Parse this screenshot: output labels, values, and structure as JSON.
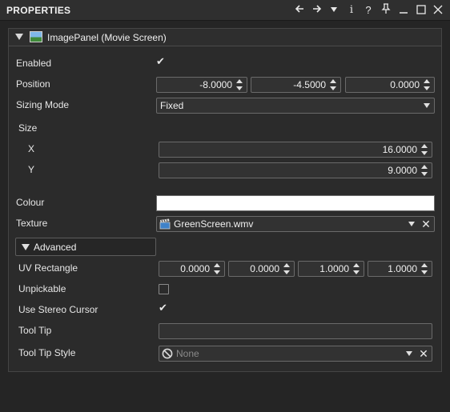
{
  "window": {
    "title": "PROPERTIES",
    "icons": [
      "arrow-left-icon",
      "arrow-right-icon",
      "dropdown-icon",
      "info-icon",
      "help-icon",
      "pin-icon",
      "minimize-icon",
      "maximize-icon",
      "close-icon"
    ]
  },
  "panel": {
    "title": "ImagePanel (Movie Screen)",
    "icon": "image-icon"
  },
  "props": {
    "enabled": {
      "label": "Enabled",
      "checked": true
    },
    "position": {
      "label": "Position",
      "values": [
        "-8.0000",
        "-4.5000",
        "0.0000"
      ]
    },
    "sizing_mode": {
      "label": "Sizing Mode",
      "value": "Fixed"
    },
    "size": {
      "label": "Size",
      "x_label": "X",
      "x_value": "16.0000",
      "y_label": "Y",
      "y_value": "9.0000"
    },
    "colour": {
      "label": "Colour",
      "value": "#ffffff"
    },
    "texture": {
      "label": "Texture",
      "value": "GreenScreen.wmv",
      "icon": "movie-clapper-icon"
    }
  },
  "advanced": {
    "label": "Advanced",
    "uv_rectangle": {
      "label": "UV Rectangle",
      "values": [
        "0.0000",
        "0.0000",
        "1.0000",
        "1.0000"
      ]
    },
    "unpickable": {
      "label": "Unpickable",
      "checked": false
    },
    "use_stereo_cursor": {
      "label": "Use Stereo Cursor",
      "checked": true
    },
    "tool_tip": {
      "label": "Tool Tip",
      "value": ""
    },
    "tool_tip_style": {
      "label": "Tool Tip Style",
      "value": "None",
      "icon": "none-icon"
    }
  },
  "colors": {
    "background": "#252525",
    "panel": "#2b2b2b",
    "field": "#323232",
    "border": "#6a6a6a",
    "text": "#e6e6e6"
  }
}
